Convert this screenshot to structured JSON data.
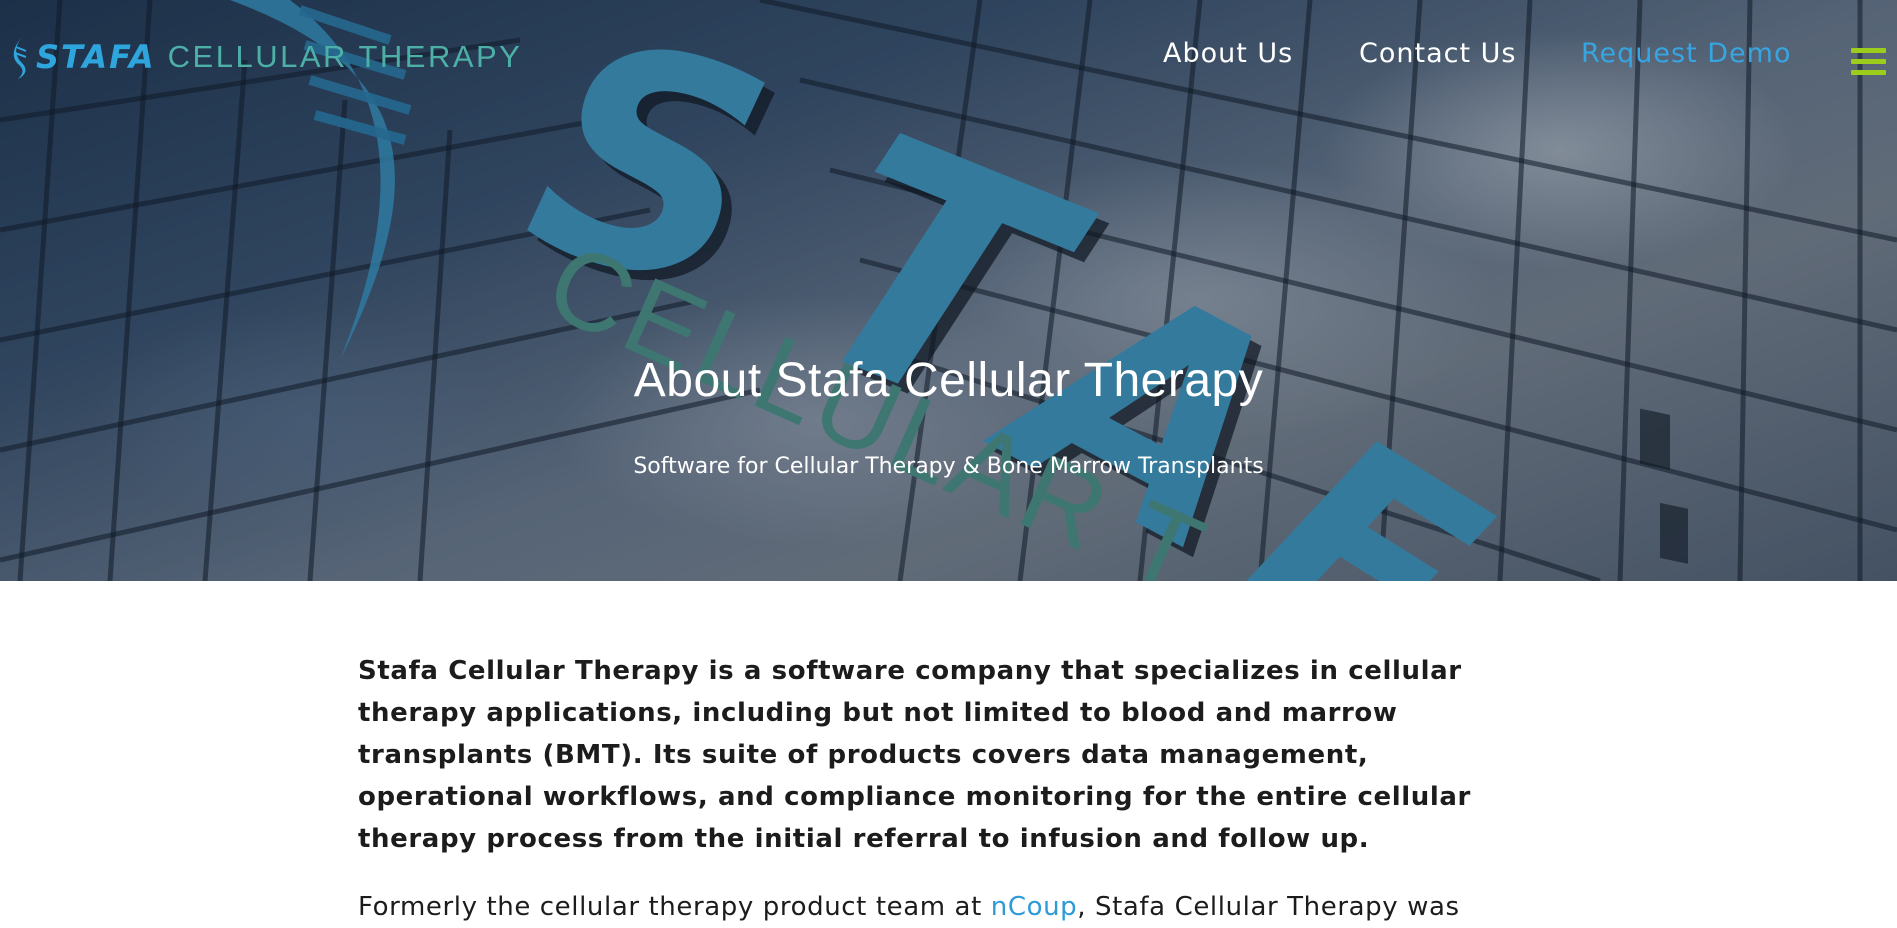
{
  "brand": {
    "name_strong": "STAFA",
    "name_light": "CELLULAR THERAPY",
    "logo_icon": "dna-helix-icon",
    "color_strong": "#2ea5dc",
    "color_light": "#4db0a7"
  },
  "nav": {
    "items": [
      {
        "label": "About Us"
      },
      {
        "label": "Contact Us"
      },
      {
        "label": "Request Demo",
        "accent": "#36a6e2"
      }
    ],
    "menu_icon": "hamburger-menu-icon",
    "menu_icon_color": "#9ccc1c"
  },
  "hero": {
    "title": "About Stafa Cellular Therapy",
    "subtitle": "Software for Cellular Therapy & Bone Marrow Transplants"
  },
  "content": {
    "lead": "Stafa Cellular Therapy is a software company that specializes in cellular therapy applications, including but not limited to blood and marrow transplants (BMT). Its suite of products covers data management, operational workflows, and compliance monitoring for the entire cellular therapy process from the initial referral to infusion and follow up.",
    "para_prefix": "Formerly the cellular therapy product team at ",
    "para_link": "nCoup",
    "para_suffix": ", Stafa Cellular Therapy was"
  }
}
